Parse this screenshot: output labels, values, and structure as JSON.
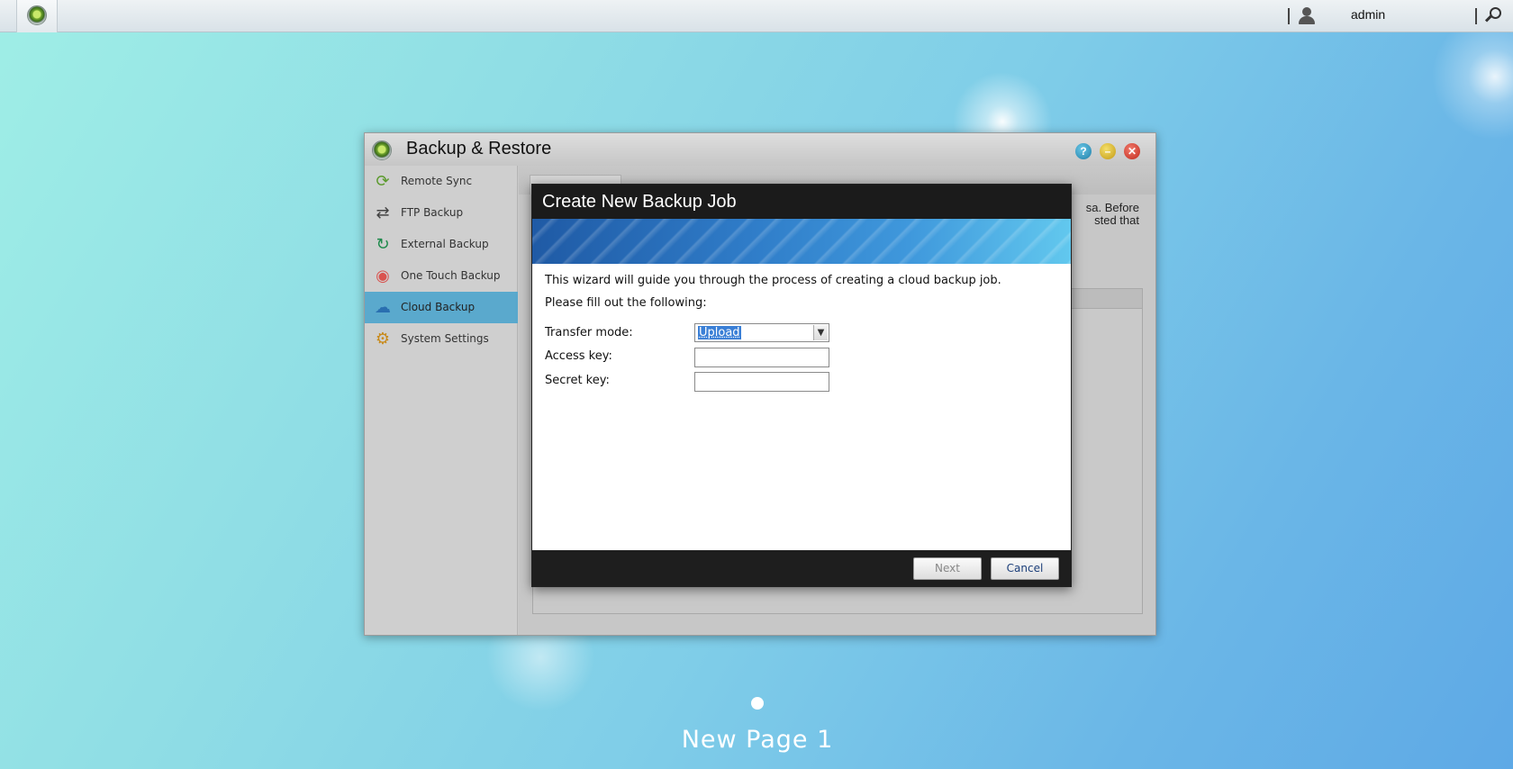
{
  "taskbar": {
    "user_name": "admin"
  },
  "window": {
    "title": "Backup & Restore",
    "controls": {
      "help": "?",
      "minimize": "–",
      "close": "✕"
    },
    "sidebar": {
      "items": [
        {
          "label": "Remote Sync",
          "icon": "remote-sync-icon",
          "glyph": "⟳",
          "color": "#5b9a2c"
        },
        {
          "label": "FTP Backup",
          "icon": "ftp-backup-icon",
          "glyph": "⇄",
          "color": "#444444"
        },
        {
          "label": "External Backup",
          "icon": "external-backup-icon",
          "glyph": "↻",
          "color": "#1f8a4c"
        },
        {
          "label": "One Touch Backup",
          "icon": "one-touch-backup-icon",
          "glyph": "◉",
          "color": "#d9534f"
        },
        {
          "label": "Cloud Backup",
          "icon": "cloud-backup-icon",
          "glyph": "☁",
          "color": "#2a6fb0"
        },
        {
          "label": "System Settings",
          "icon": "system-settings-icon",
          "glyph": "⚙",
          "color": "#c88a1a"
        }
      ],
      "active_index": 4
    },
    "description_fragment": {
      "line1": "sa. Before",
      "line2": "sted that"
    }
  },
  "modal": {
    "title": "Create New Backup Job",
    "intro": "This wizard will guide you through the process of creating a cloud backup job.",
    "fill_out": "Please fill out the following:",
    "fields": {
      "transfer_mode_label": "Transfer mode:",
      "transfer_mode_value": "Upload",
      "access_key_label": "Access key:",
      "access_key_value": "",
      "secret_key_label": "Secret key:",
      "secret_key_value": ""
    },
    "buttons": {
      "next": "Next",
      "cancel": "Cancel"
    }
  },
  "desktop": {
    "page_label": "New Page 1"
  }
}
